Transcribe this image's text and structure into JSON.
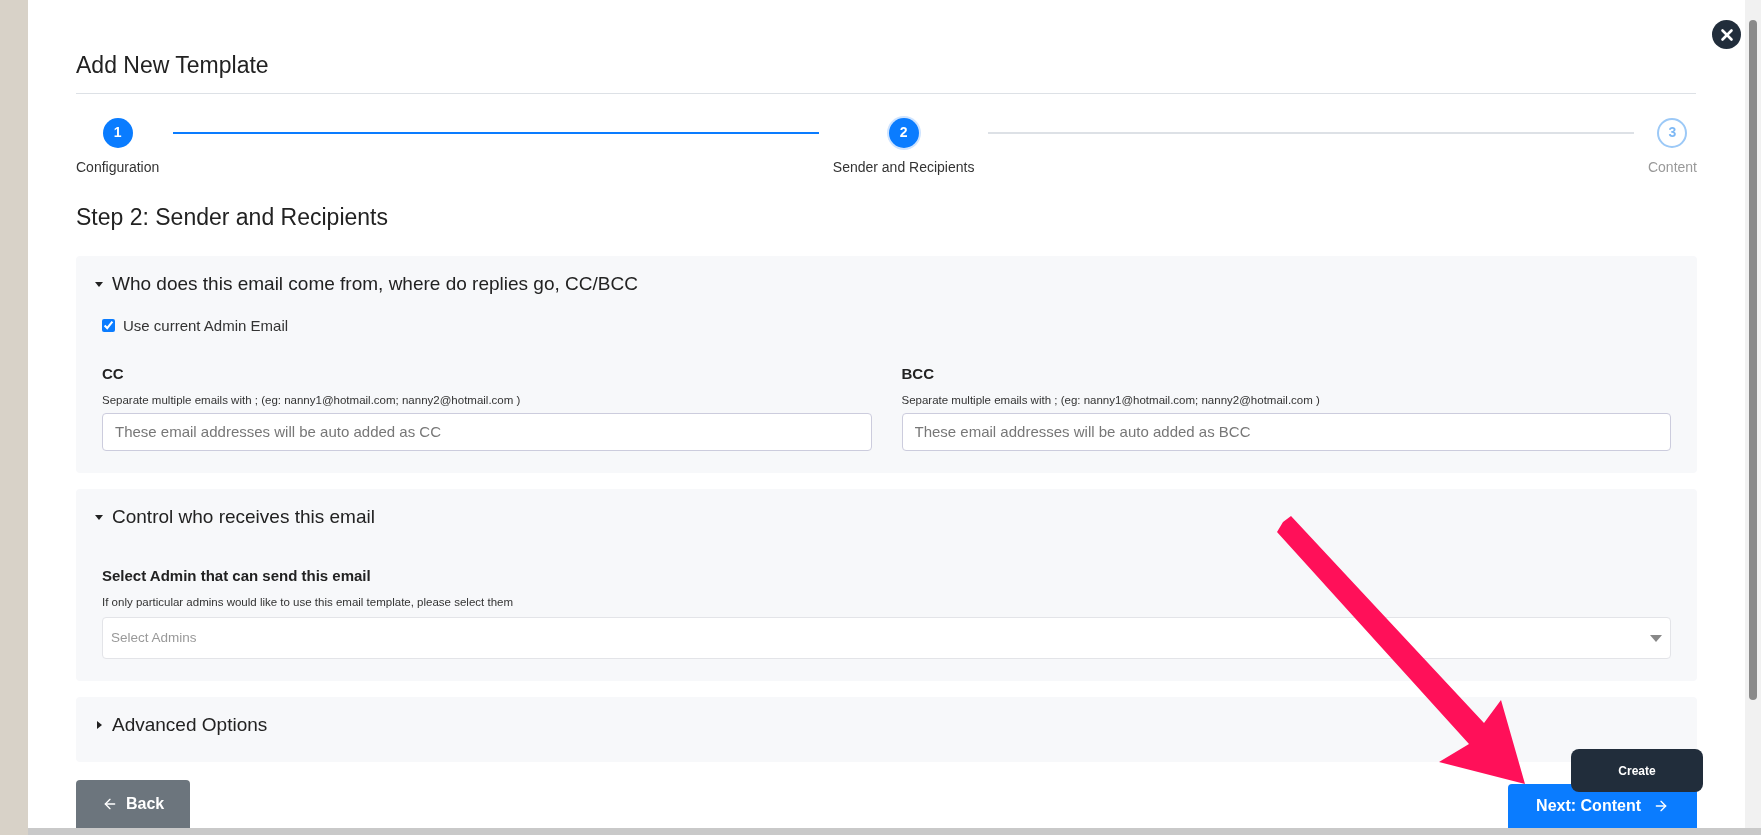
{
  "dialog": {
    "title": "Add New Template"
  },
  "stepper": [
    {
      "number": "1",
      "label": "Configuration",
      "completed": true,
      "selected": false
    },
    {
      "number": "2",
      "label": "Sender and Recipients",
      "completed": false,
      "selected": true
    },
    {
      "number": "3",
      "label": "Content",
      "completed": false,
      "selected": false
    }
  ],
  "step_heading": "Step 2: Sender and Recipients",
  "sections": [
    {
      "kind": "sender",
      "title": "Who does this email come from, where do replies go, CC/BCC",
      "expanded": true,
      "checkbox": {
        "label": "Use current Admin Email",
        "checked": true
      },
      "fields": [
        {
          "label": "CC",
          "hint": "Separate multiple emails with ; (eg: nanny1@hotmail.com; nanny2@hotmail.com )",
          "placeholder": "These email addresses will be auto added as CC"
        },
        {
          "label": "BCC",
          "hint": "Separate multiple emails with ; (eg: nanny1@hotmail.com; nanny2@hotmail.com )",
          "placeholder": "These email addresses will be auto added as BCC"
        }
      ]
    },
    {
      "kind": "admins",
      "title": "Control who receives this email",
      "expanded": true,
      "field_label": "Select Admin that can send this email",
      "hint": "If only particular admins would like to use this email template, please select them",
      "select_placeholder": "Select Admins"
    },
    {
      "kind": "collapsed",
      "title": "Advanced Options",
      "expanded": false
    }
  ],
  "footer": {
    "back": "Back",
    "next": "Next: Content",
    "tooltip": "Create"
  }
}
